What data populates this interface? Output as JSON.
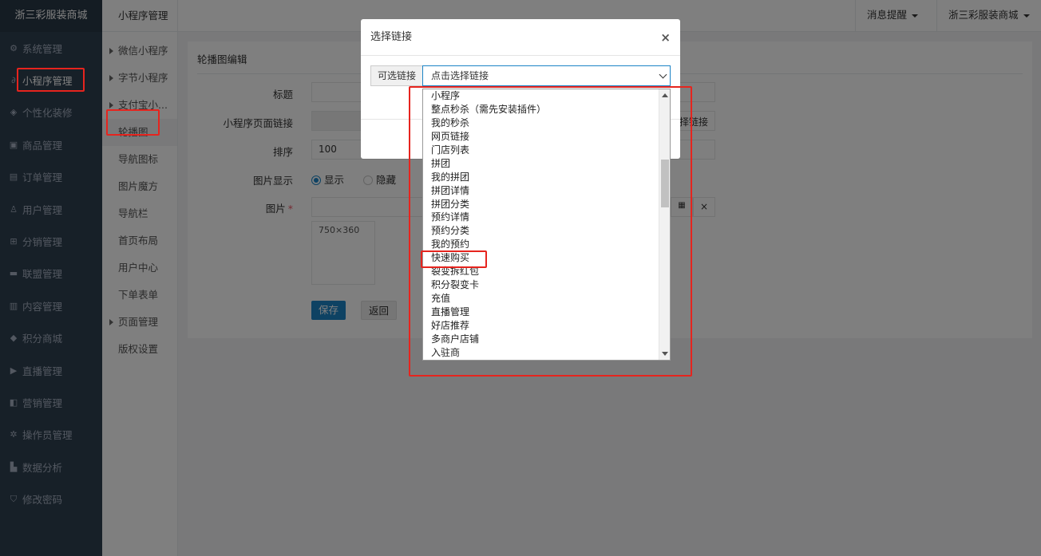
{
  "sidebar": {
    "brand": "浙三彩服装商城",
    "items": [
      {
        "label": "系统管理",
        "icon": "gear-icon"
      },
      {
        "label": "小程序管理",
        "icon": "link-icon"
      },
      {
        "label": "个性化装修",
        "icon": "brush-icon"
      },
      {
        "label": "商品管理",
        "icon": "bag-icon"
      },
      {
        "label": "订单管理",
        "icon": "clipboard-icon"
      },
      {
        "label": "用户管理",
        "icon": "user-icon"
      },
      {
        "label": "分销管理",
        "icon": "sitemap-icon"
      },
      {
        "label": "联盟管理",
        "icon": "store-icon"
      },
      {
        "label": "内容管理",
        "icon": "newspaper-icon"
      },
      {
        "label": "积分商城",
        "icon": "cube-icon"
      },
      {
        "label": "直播管理",
        "icon": "play-icon"
      },
      {
        "label": "营销管理",
        "icon": "megaphone-icon"
      },
      {
        "label": "操作员管理",
        "icon": "cog-icon"
      },
      {
        "label": "数据分析",
        "icon": "bar-chart-icon"
      },
      {
        "label": "修改密码",
        "icon": "shield-icon"
      }
    ]
  },
  "submenu": {
    "title": "小程序管理",
    "items": [
      {
        "label": "微信小程序"
      },
      {
        "label": "字节小程序"
      },
      {
        "label": "支付宝小..."
      },
      {
        "label": "轮播图"
      },
      {
        "label": "导航图标"
      },
      {
        "label": "图片魔方"
      },
      {
        "label": "导航栏"
      },
      {
        "label": "首页布局"
      },
      {
        "label": "用户中心"
      },
      {
        "label": "下单表单"
      },
      {
        "label": "页面管理"
      },
      {
        "label": "版权设置"
      }
    ]
  },
  "topbar": {
    "notifications": "消息提醒",
    "store": "浙三彩服装商城"
  },
  "form": {
    "section_title": "轮播图编辑",
    "title_label": "标题",
    "title_value": "",
    "page_link_label": "小程序页面链接",
    "select_link_button": "择链接",
    "sort_label": "排序",
    "sort_value": "100",
    "display_label": "图片显示",
    "display_show": "显示",
    "display_hide": "隐藏",
    "image_label": "图片",
    "image_required": "*",
    "image_placeholder": "750×360",
    "save_button": "保存",
    "back_button": "返回"
  },
  "modal": {
    "title": "选择链接",
    "close": "×",
    "addon_label": "可选链接",
    "select_value": "点击选择链接",
    "options": [
      "小程序",
      "整点秒杀（需先安装插件）",
      "我的秒杀",
      "网页链接",
      "门店列表",
      "拼团",
      "我的拼团",
      "拼团详情",
      "拼团分类",
      "预约详情",
      "预约分类",
      "我的预约",
      "快速购买",
      "裂变拆红包",
      "积分裂变卡",
      "充值",
      "直播管理",
      "好店推荐",
      "多商户店铺",
      "入驻商"
    ]
  },
  "colors": {
    "sidebar_bg": "#2f4050",
    "primary": "#1c84c6",
    "highlight": "#e6241e"
  }
}
